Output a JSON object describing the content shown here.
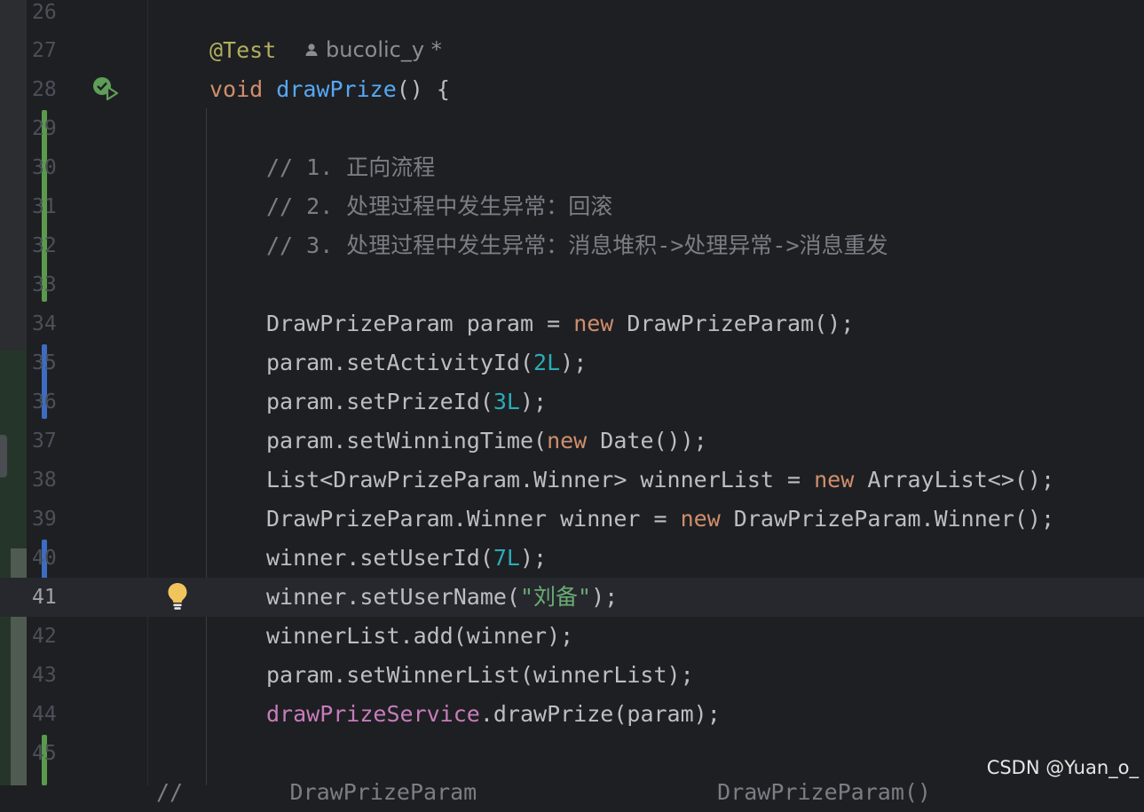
{
  "editor": {
    "author_annotation": "bucolic_y *",
    "lines": [
      {
        "num": "26"
      },
      {
        "num": "27",
        "ann": "@Test"
      },
      {
        "num": "28",
        "kw": "void",
        "fn": "drawPrize",
        "rest": "() {"
      },
      {
        "num": "29"
      },
      {
        "num": "30",
        "comment": "// 1. 正向流程"
      },
      {
        "num": "31",
        "comment": "// 2. 处理过程中发生异常：回滚"
      },
      {
        "num": "32",
        "comment": "// 3. 处理过程中发生异常：消息堆积->处理异常->消息重发"
      },
      {
        "num": "33"
      },
      {
        "num": "34",
        "a": "DrawPrizeParam param = ",
        "kw": "new",
        "b": " DrawPrizeParam();"
      },
      {
        "num": "35",
        "a": "param.setActivityId(",
        "n": "2L",
        "b": ");"
      },
      {
        "num": "36",
        "a": "param.setPrizeId(",
        "n": "3L",
        "b": ");"
      },
      {
        "num": "37",
        "a": "param.setWinningTime(",
        "kw": "new",
        "b": " Date());"
      },
      {
        "num": "38",
        "a": "List<DrawPrizeParam.Winner> winnerList = ",
        "kw": "new",
        "b": " ArrayList<>();"
      },
      {
        "num": "39",
        "a": "DrawPrizeParam.Winner winner = ",
        "kw": "new",
        "b": " DrawPrizeParam.Winner();"
      },
      {
        "num": "40",
        "a": "winner.setUserId(",
        "n": "7L",
        "b": ");"
      },
      {
        "num": "41",
        "a": "winner.setUserName(",
        "s": "\"刘备\"",
        "b": ");"
      },
      {
        "num": "42",
        "a": "winnerList.add(winner);"
      },
      {
        "num": "43",
        "a": "param.setWinnerList(winnerList);"
      },
      {
        "num": "44",
        "f": "drawPrizeService",
        "a": ".drawPrize(param);"
      },
      {
        "num": "45"
      }
    ],
    "partial_line": "//        DrawPrizeParam                  DrawPrizeParam()"
  },
  "watermark": "CSDN @Yuan_o_",
  "colors": {
    "background": "#1e1f22",
    "keyword": "#cf8e6d",
    "function": "#56a8f5",
    "annotation": "#b3ae60",
    "number": "#2aacb8",
    "string": "#6aab73",
    "comment": "#7a7e85",
    "field": "#c77dbb",
    "change_added": "#5a9a4c",
    "change_modified": "#3d6cc0"
  },
  "icons": [
    "run-test-icon",
    "person-icon",
    "intention-bulb-icon"
  ]
}
